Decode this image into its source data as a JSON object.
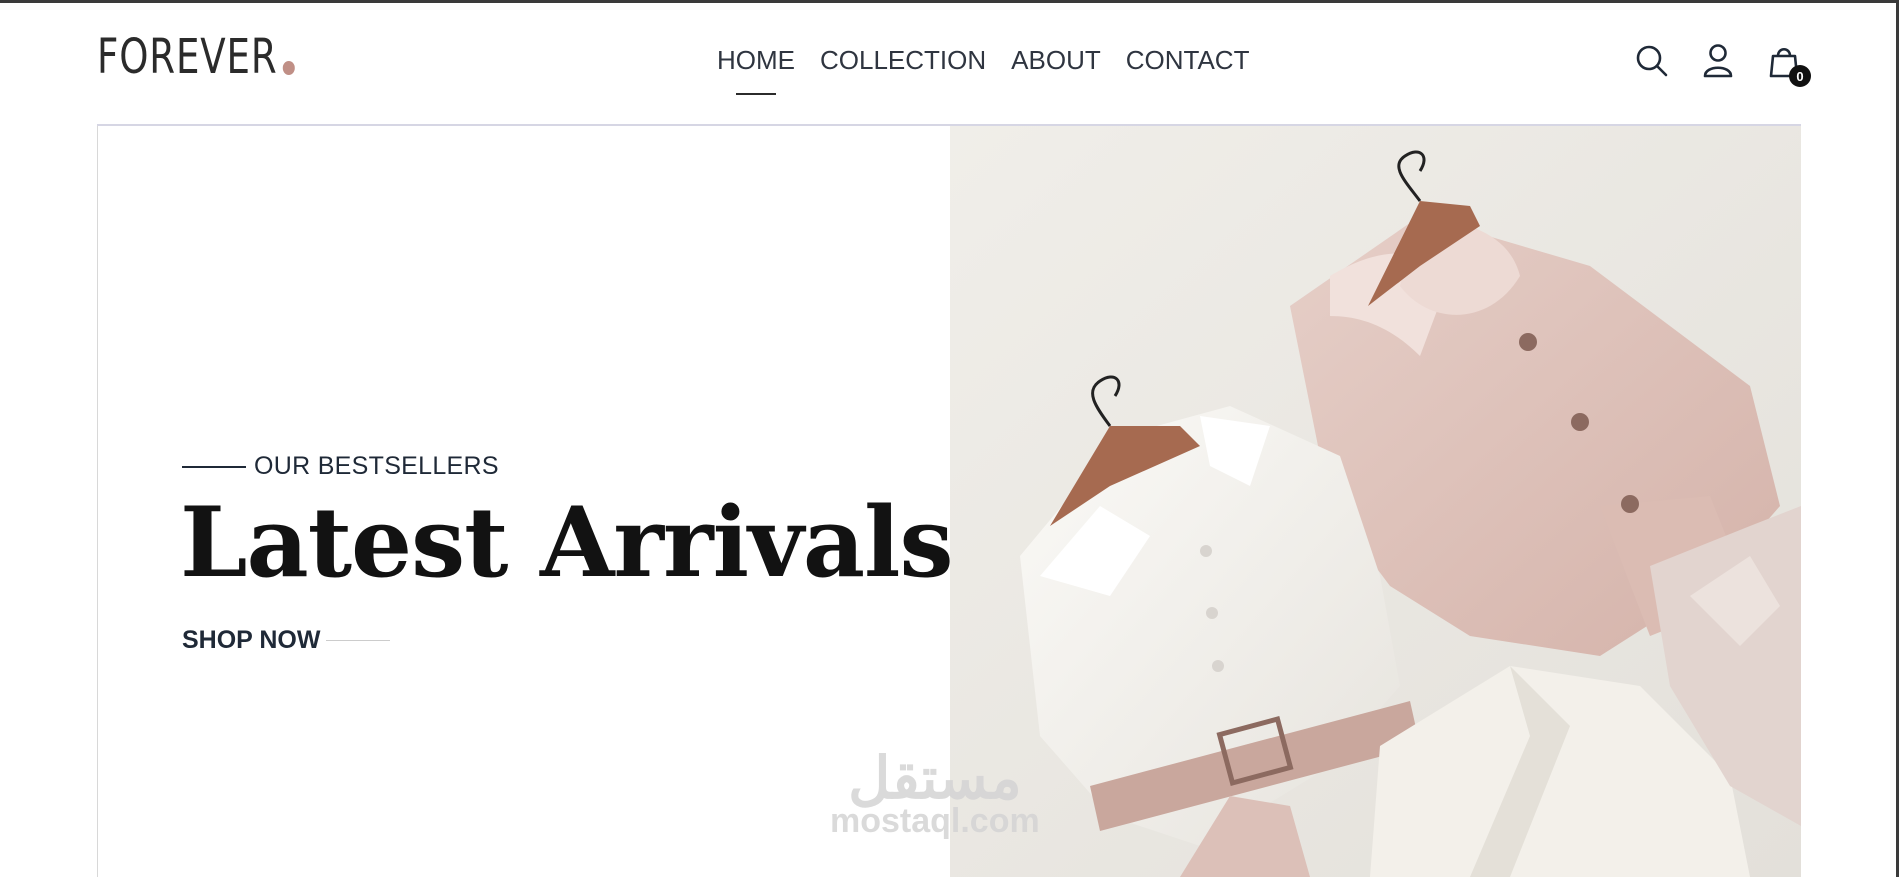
{
  "brand": {
    "name": "FOREVER",
    "dot_color": "#c08f86"
  },
  "nav": [
    {
      "label": "HOME",
      "active": true
    },
    {
      "label": "COLLECTION",
      "active": false
    },
    {
      "label": "ABOUT",
      "active": false
    },
    {
      "label": "CONTACT",
      "active": false
    }
  ],
  "header_icons": {
    "search": "search-icon",
    "profile": "profile-icon",
    "cart": "cart-icon",
    "cart_count": "0"
  },
  "hero": {
    "eyebrow": "OUR BESTSELLERS",
    "title": "Latest Arrivals",
    "cta": "SHOP NOW",
    "image": "folded-clothes-on-hangers"
  },
  "watermark": {
    "arabic": "مستقل",
    "latin": "mostaql.com"
  },
  "colors": {
    "text_dark": "#1f2937",
    "pink": "#d9b8b0",
    "cream_bg": "#eceae5",
    "white_fabric": "#f4f2ee",
    "hanger": "#a66a50"
  }
}
